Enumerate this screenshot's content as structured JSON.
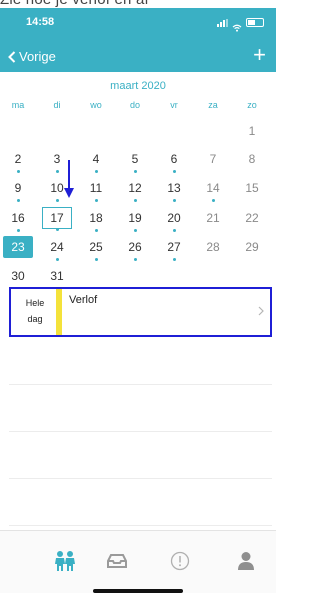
{
  "caption": "Zie hoe je verlof en af",
  "status_bar": {
    "time": "14:58"
  },
  "nav": {
    "back_label": "Vorige",
    "add_label": "+"
  },
  "calendar": {
    "month_label": "maart 2020",
    "weekdays": [
      "ma",
      "di",
      "wo",
      "do",
      "vr",
      "za",
      "zo"
    ],
    "weeks": [
      [
        "",
        "",
        "",
        "",
        "",
        "",
        "1"
      ],
      [
        "2",
        "3",
        "4",
        "5",
        "6",
        "7",
        "8"
      ],
      [
        "9",
        "10",
        "11",
        "12",
        "13",
        "14",
        "15"
      ],
      [
        "16",
        "17",
        "18",
        "19",
        "20",
        "21",
        "22"
      ],
      [
        "23",
        "24",
        "25",
        "26",
        "27",
        "28",
        "29"
      ],
      [
        "30",
        "31",
        "",
        "",
        "",
        "",
        ""
      ]
    ],
    "today": "17",
    "selected": "23",
    "days_with_dot": [
      "2",
      "3",
      "4",
      "5",
      "6",
      "9",
      "10",
      "11",
      "12",
      "13",
      "14",
      "16",
      "17",
      "18",
      "19",
      "20",
      "24",
      "25",
      "26",
      "27",
      "30",
      "31"
    ]
  },
  "event": {
    "time_label_line1": "Hele",
    "time_label_line2": "dag",
    "title": "Verlof",
    "color": "#f4e23a"
  },
  "tabbar": {
    "items": [
      {
        "icon": "people-icon",
        "active": true
      },
      {
        "icon": "inbox-icon",
        "active": false
      },
      {
        "icon": "alert-circle-icon",
        "active": false
      },
      {
        "icon": "person-icon",
        "active": false
      }
    ]
  },
  "colors": {
    "accent": "#3ab0c4",
    "highlight_border": "#1f1fd6",
    "annotation_arrow": "#1f1fd6"
  }
}
